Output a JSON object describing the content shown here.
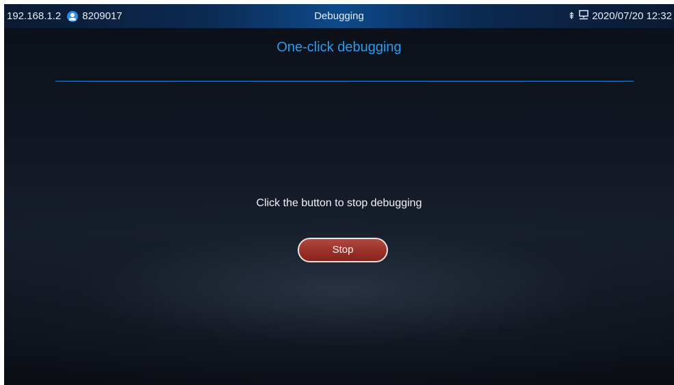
{
  "status_bar": {
    "ip_address": "192.168.1.2",
    "account_number": "8209017",
    "title": "Debugging",
    "datetime": "2020/07/20 12:32",
    "icons": [
      "user-icon",
      "usb-icon",
      "network-icon"
    ]
  },
  "page": {
    "title": "One-click debugging",
    "message": "Click the button to stop debugging",
    "stop_button_label": "Stop"
  },
  "colors": {
    "accent": "#2a9cf0",
    "button": "#9a3028",
    "background": "#121824"
  }
}
